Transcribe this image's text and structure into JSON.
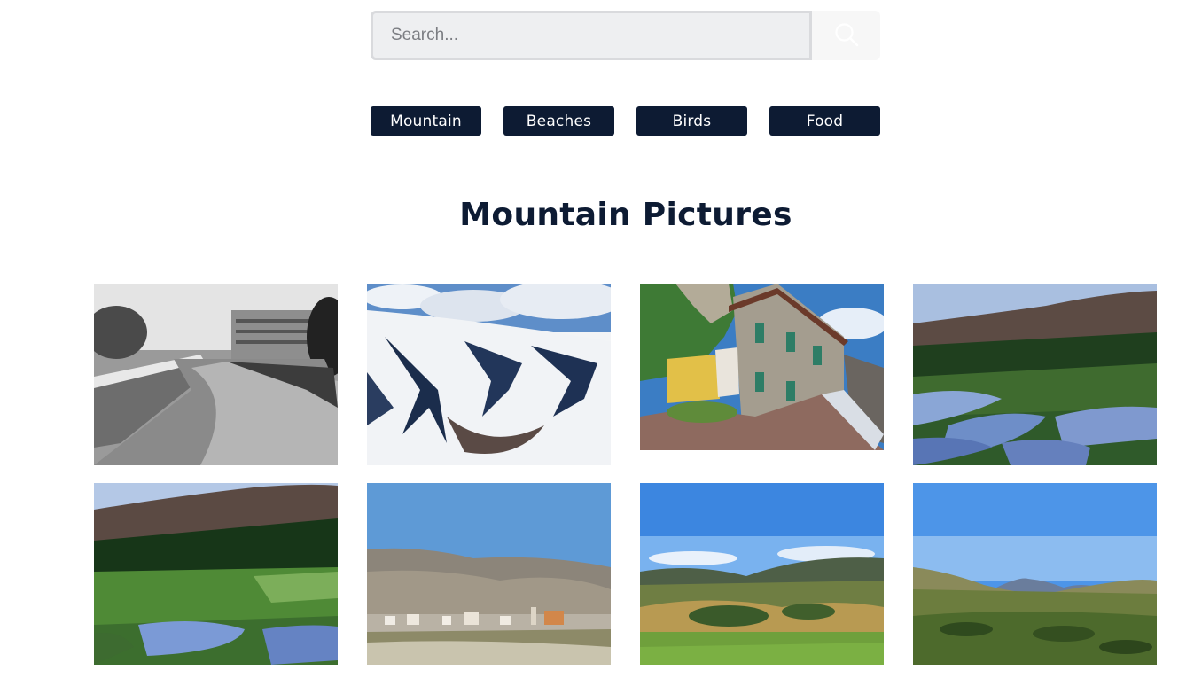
{
  "search": {
    "placeholder": "Search...",
    "icon": "search-icon"
  },
  "categories": [
    {
      "label": "Mountain"
    },
    {
      "label": "Beaches"
    },
    {
      "label": "Birds"
    },
    {
      "label": "Food"
    }
  ],
  "page_title": "Mountain Pictures",
  "colors": {
    "primary": "#0d1b33",
    "search_bg": "#eeeff1",
    "search_border": "#d9dadd"
  }
}
